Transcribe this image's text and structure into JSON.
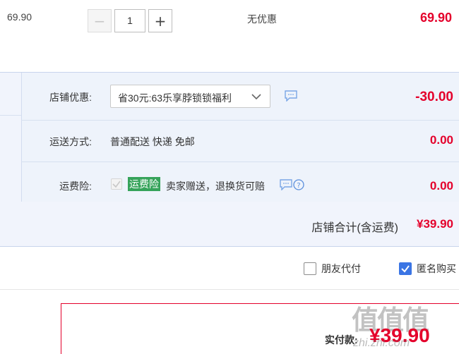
{
  "item": {
    "unit_price": "69.90",
    "quantity": "1",
    "promotion": "无优惠",
    "subtotal": "69.90"
  },
  "shop": {
    "discount_label": "店铺优惠:",
    "discount_selected": "省30元:63乐享脖锁锁福利",
    "discount_amount": "-30.00",
    "shipping_label": "运送方式:",
    "shipping_value": "普通配送 快递 免邮",
    "shipping_amount": "0.00",
    "insurance_label": "运费险:",
    "insurance_tag": "运费险",
    "insurance_desc": "卖家赠送，退换货可赔",
    "insurance_amount": "0.00",
    "total_label": "店铺合计(含运费)",
    "total_amount": "¥39.90"
  },
  "options": {
    "friend_pay": "朋友代付",
    "anonymous": "匿名购买"
  },
  "payment": {
    "label": "实付款:",
    "amount": "¥39.90"
  },
  "watermark": {
    "main": "值值值",
    "sub": "zhi.zhi.com"
  },
  "colors": {
    "accent_red": "#e4002b",
    "panel_blue": "#f1f4fc",
    "checkbox_blue": "#3b75e4",
    "tag_green": "#36a35a"
  }
}
